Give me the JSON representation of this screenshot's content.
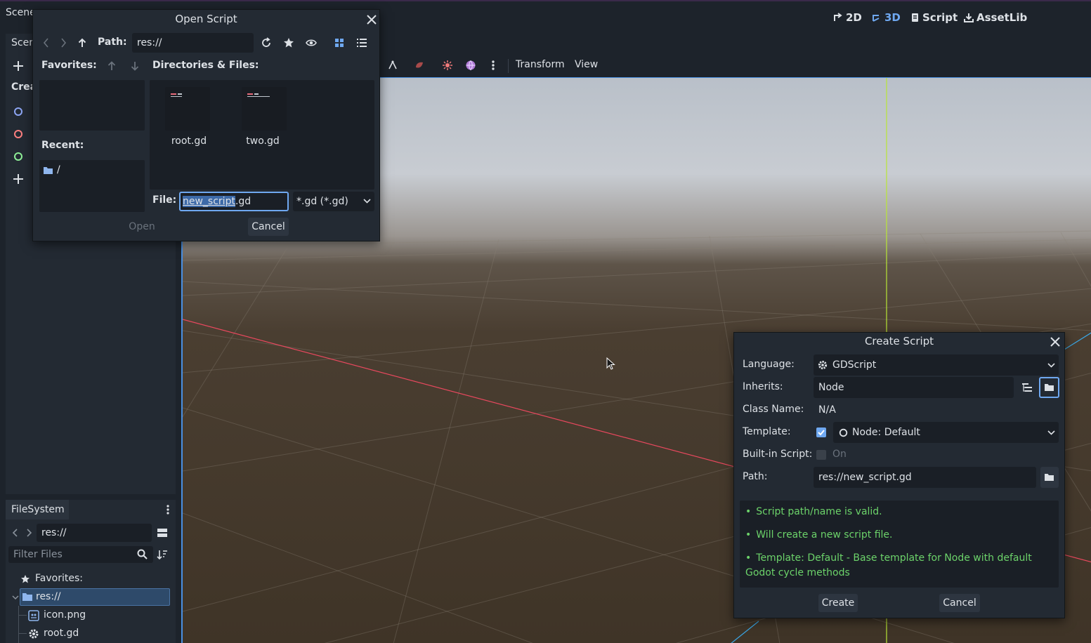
{
  "topbar": {
    "workspaces": [
      {
        "label": "2D",
        "icon": "2d-icon"
      },
      {
        "label": "3D",
        "icon": "3d-icon",
        "active": true
      },
      {
        "label": "Script",
        "icon": "script-icon"
      },
      {
        "label": "AssetLib",
        "icon": "assetlib-icon"
      }
    ],
    "scene_tab": "Scene"
  },
  "scene_dock": {
    "tab": "Scene",
    "create_label": "Create Root Node:",
    "node_colors": [
      "#8da5f3",
      "#fc7f7f",
      "#8eef97"
    ]
  },
  "viewport_toolbar": {
    "transform": "Transform",
    "view": "View"
  },
  "filesystem": {
    "tab": "FileSystem",
    "path": "res://",
    "filter_placeholder": "Filter Files",
    "favorites": "Favorites:",
    "root": "res://",
    "files": [
      {
        "name": "icon.png",
        "icon": "image-icon"
      },
      {
        "name": "root.gd",
        "icon": "gear-icon"
      }
    ]
  },
  "open_script": {
    "title": "Open Script",
    "path_label": "Path:",
    "path_value": "res://",
    "favorites_label": "Favorites:",
    "recent_label": "Recent:",
    "recent_items": [
      "/"
    ],
    "dirs_label": "Directories & Files:",
    "files": [
      "root.gd",
      "two.gd"
    ],
    "file_label": "File:",
    "file_selected_part": "new_script",
    "file_rest": ".gd",
    "filter": "*.gd (*.gd)",
    "open_btn": "Open",
    "cancel_btn": "Cancel"
  },
  "create_script": {
    "title": "Create Script",
    "language_label": "Language:",
    "language_value": "GDScript",
    "inherits_label": "Inherits:",
    "inherits_value": "Node",
    "class_label": "Class Name:",
    "class_value": "N/A",
    "template_label": "Template:",
    "template_checked": true,
    "template_value": "Node: Default",
    "builtin_label": "Built-in Script:",
    "builtin_value": "On",
    "path_label": "Path:",
    "path_value": "res://new_script.gd",
    "messages": [
      "Script path/name is valid.",
      "Will create a new script file.",
      "Template: Default - Base template for Node with default Godot cycle methods"
    ],
    "message_color": "#6cd36a",
    "create_btn": "Create",
    "cancel_btn": "Cancel"
  },
  "colors": {
    "accent": "#4a90e2",
    "x_axis": "#e8485e",
    "y_axis": "#b8e636",
    "z_axis": "#3aa8e8"
  }
}
